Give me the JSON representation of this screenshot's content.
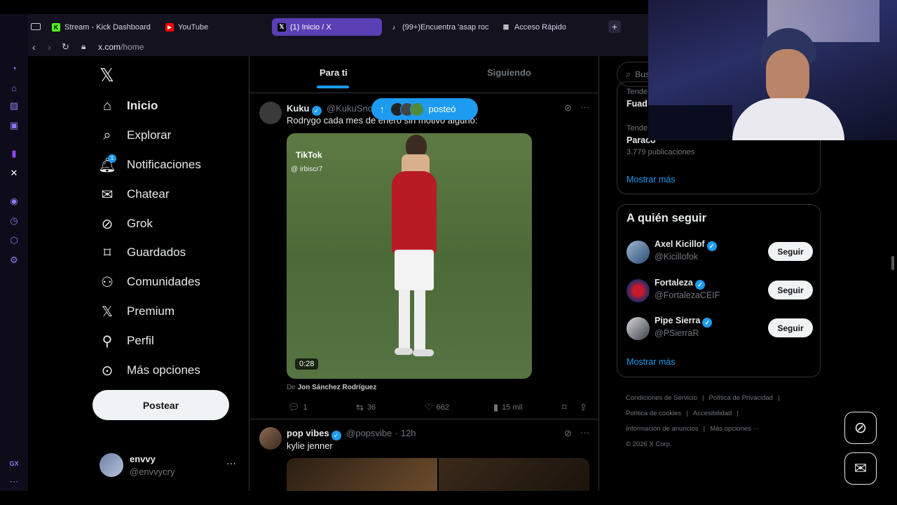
{
  "browser": {
    "tabs": [
      {
        "label": "Stream - Kick Dashboard",
        "favicon": "kick-icon",
        "color": "#53fc18"
      },
      {
        "label": "YouTube",
        "favicon": "youtube-icon",
        "color": "#ff0000"
      },
      {
        "label": "(1) Inicio / X",
        "favicon": "x-icon",
        "color": "#ffffff"
      },
      {
        "label": "(99+)Encuentra 'asap roc",
        "favicon": "tiktok-icon",
        "color": "#ffffff"
      },
      {
        "label": "Acceso Rápido",
        "favicon": "grid-icon",
        "color": "#cccccc"
      }
    ],
    "new_tab": "+",
    "url_host": "x.com",
    "url_path": "/home"
  },
  "rail": {
    "bottom_label": "GX"
  },
  "nav": {
    "items": [
      {
        "label": "Inicio",
        "icon": "home-icon"
      },
      {
        "label": "Explorar",
        "icon": "search-icon"
      },
      {
        "label": "Notificaciones",
        "icon": "bell-icon",
        "badge": "1"
      },
      {
        "label": "Chatear",
        "icon": "mail-icon"
      },
      {
        "label": "Grok",
        "icon": "grok-icon"
      },
      {
        "label": "Guardados",
        "icon": "bookmark-icon"
      },
      {
        "label": "Comunidades",
        "icon": "communities-icon"
      },
      {
        "label": "Premium",
        "icon": "x-icon"
      },
      {
        "label": "Perfil",
        "icon": "person-icon"
      },
      {
        "label": "Más opciones",
        "icon": "more-circle-icon"
      }
    ],
    "post_label": "Postear",
    "account": {
      "name": "envvy",
      "handle": "@envvycry"
    }
  },
  "feed": {
    "tabs": [
      "Para ti",
      "Siguiendo"
    ],
    "posted_pill": "posteó",
    "tweet1": {
      "name": "Kuku",
      "handle": "@KukuSnoo",
      "text": "Rodrygo cada mes de enero sin motivo alguno:",
      "tiktok_label": "TikTok",
      "tiktok_user": "@ irbiscr7",
      "video_duration": "0:28",
      "source_prefix": "De",
      "source_name": "Jon Sánchez Rodríguez",
      "replies": "1",
      "reposts": "36",
      "likes": "662",
      "views": "15 mil"
    },
    "tweet2": {
      "name": "pop vibes",
      "handle": "@popsvibe",
      "time": "· 12h",
      "text": "kylie jenner"
    }
  },
  "sidebar": {
    "search_placeholder": "Bus",
    "trends": [
      {
        "meta": "Tende",
        "name": "Fuad",
        "count": ""
      },
      {
        "meta": "Tende",
        "name": "Paraco",
        "count": "3.779 publicaciones"
      }
    ],
    "show_more": "Mostrar más",
    "who_to_follow_title": "A quién seguir",
    "follows": [
      {
        "name": "Axel Kicillof",
        "handle": "@Kicillofok",
        "button": "Seguir"
      },
      {
        "name": "Fortaleza",
        "handle": "@FortalezaCEIF",
        "button": "Seguir"
      },
      {
        "name": "Pipe Sierra",
        "handle": "@PSierraR",
        "button": "Seguir"
      }
    ],
    "show_more_2": "Mostrar más",
    "footer": [
      "Condiciones de Servicio",
      "Política de Privacidad",
      "Política de cookies",
      "Accesibilidad",
      "Información de anuncios",
      "Más opciones ···",
      "© 2026 X Corp."
    ]
  },
  "colors": {
    "accent": "#1d9bf0",
    "tab_active": "#5a3fb5",
    "border": "#2f3336"
  }
}
